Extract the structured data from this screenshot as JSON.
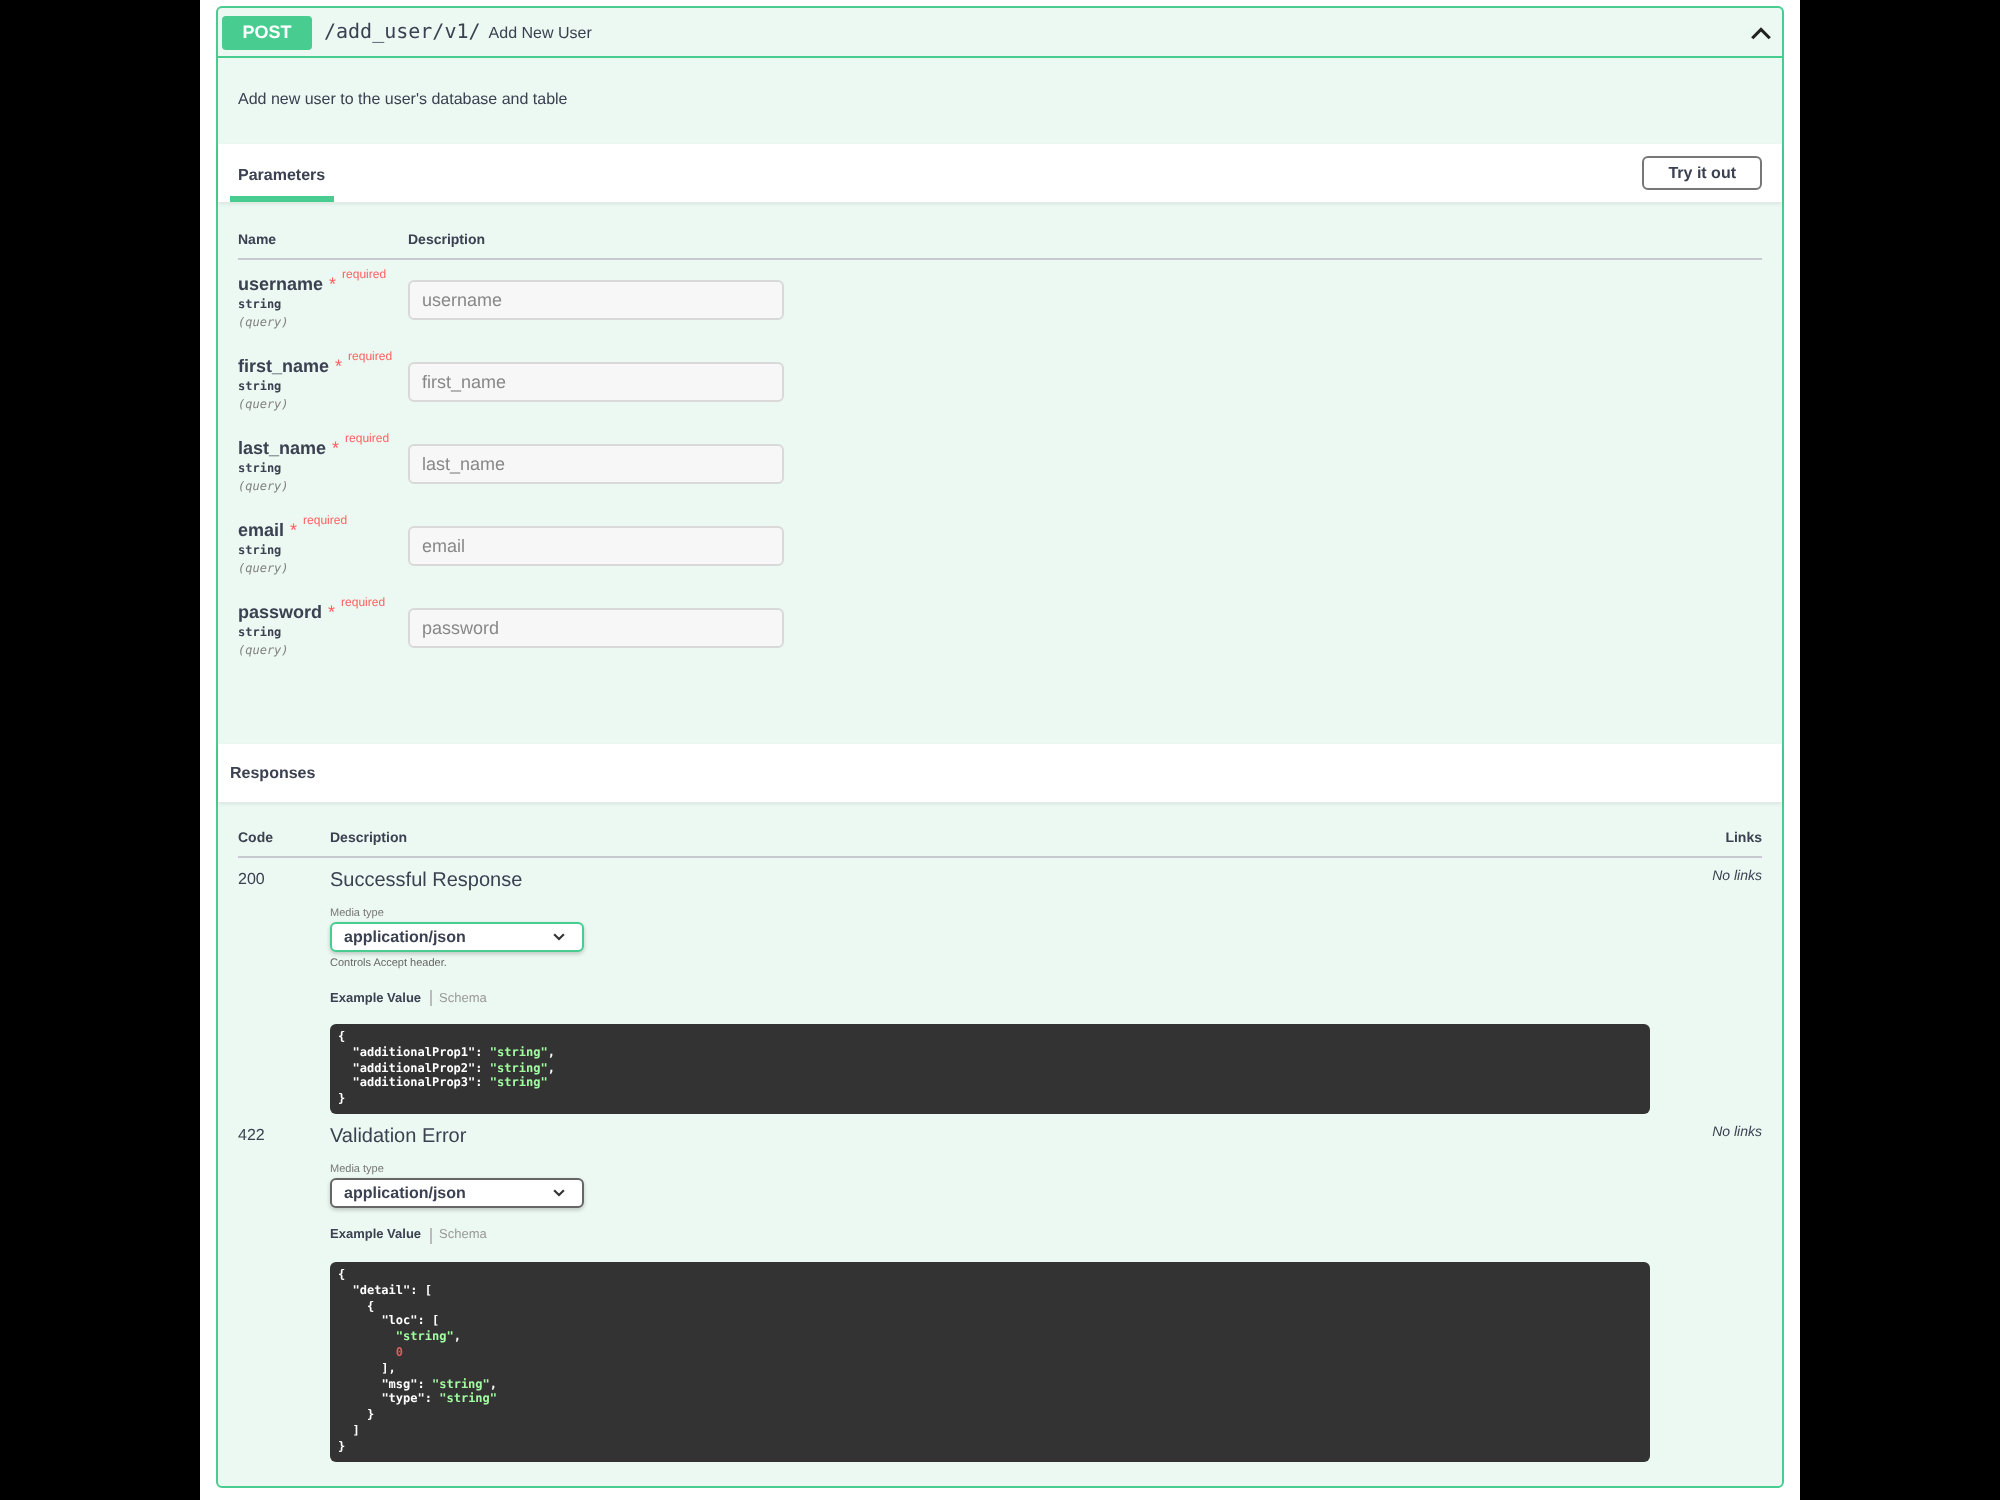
{
  "operation": {
    "method": "POST",
    "path": "/add_user/v1/",
    "summary": "Add New User",
    "expanded": true,
    "description": "Add new user to the user's database and table"
  },
  "parameters_section": {
    "title": "Parameters",
    "button": "Try it out",
    "columns": [
      "Name",
      "Description"
    ],
    "params": [
      {
        "name": "username",
        "required": true,
        "required_star": "*",
        "required_label": "required",
        "type": "string",
        "location": "(query)",
        "placeholder": "username"
      },
      {
        "name": "first_name",
        "required": true,
        "required_star": "*",
        "required_label": "required",
        "type": "string",
        "location": "(query)",
        "placeholder": "first_name"
      },
      {
        "name": "last_name",
        "required": true,
        "required_star": "*",
        "required_label": "required",
        "type": "string",
        "location": "(query)",
        "placeholder": "last_name"
      },
      {
        "name": "email",
        "required": true,
        "required_star": "*",
        "required_label": "required",
        "type": "string",
        "location": "(query)",
        "placeholder": "email"
      },
      {
        "name": "password",
        "required": true,
        "required_star": "*",
        "required_label": "required",
        "type": "string",
        "location": "(query)",
        "placeholder": "password"
      }
    ]
  },
  "responses_section": {
    "title": "Responses",
    "columns": [
      "Code",
      "Description",
      "Links"
    ],
    "responses": [
      {
        "code": "200",
        "description": "Successful Response",
        "media_label": "Media type",
        "media_type": "application/json",
        "focused": true,
        "note": "Controls Accept header.",
        "tabs": [
          {
            "label": "Example Value",
            "selected": true
          },
          {
            "label": "Schema",
            "selected": false
          }
        ],
        "example": "{\n  \"additionalProp1\": \"string\",\n  \"additionalProp2\": \"string\",\n  \"additionalProp3\": \"string\"\n}",
        "links": "No links"
      },
      {
        "code": "422",
        "description": "Validation Error",
        "media_label": "Media type",
        "media_type": "application/json",
        "focused": false,
        "tabs": [
          {
            "label": "Example Value",
            "selected": true
          },
          {
            "label": "Schema",
            "selected": false
          }
        ],
        "example": "{\n  \"detail\": [\n    {\n      \"loc\": [\n        \"string\",\n        0\n      ],\n      \"msg\": \"string\",\n      \"type\": \"string\"\n    }\n  ]\n}",
        "links": "No links"
      }
    ]
  }
}
